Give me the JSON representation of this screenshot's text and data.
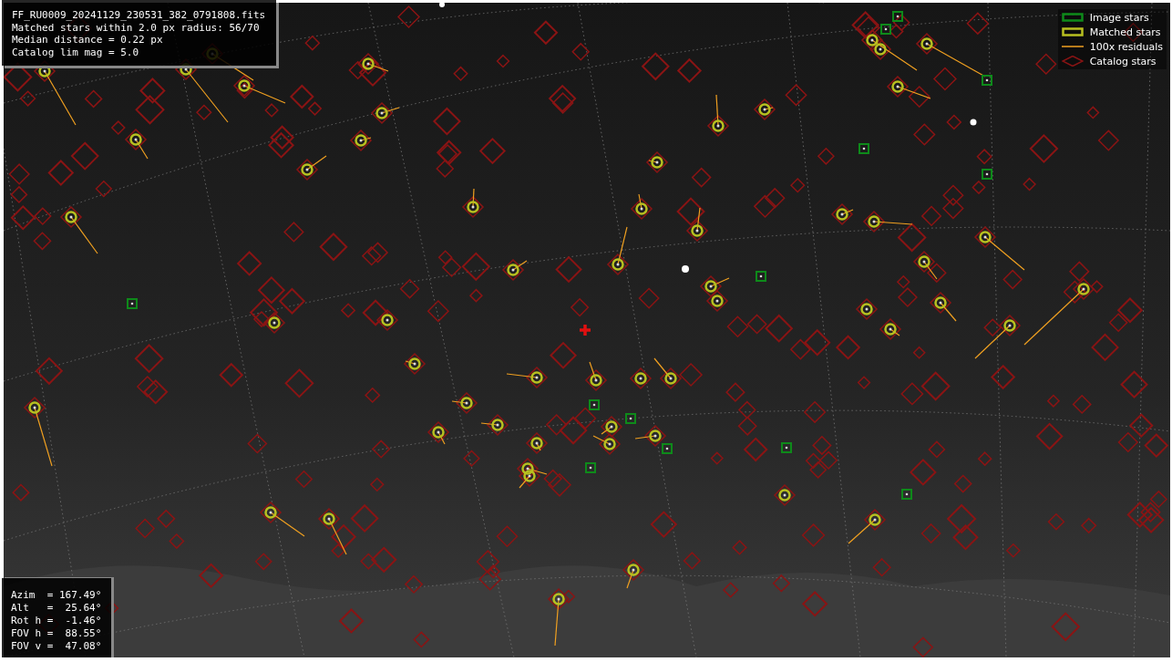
{
  "info_box": {
    "lines": [
      "FF_RU0009_20241129_230531_382_0791808.fits",
      "Matched stars within 2.0 px radius: 56/70",
      "Median distance = 0.22 px",
      "Catalog lim mag = 5.0"
    ]
  },
  "legend": {
    "items": [
      {
        "kind": "image",
        "label": "Image stars"
      },
      {
        "kind": "matched",
        "label": "Matched stars"
      },
      {
        "kind": "residual",
        "label": "100x residuals"
      },
      {
        "kind": "catalog",
        "label": "Catalog stars"
      }
    ]
  },
  "pointing": {
    "lines": [
      "Azim  = 167.49°",
      "Alt   =  25.64°",
      "Rot h =  -1.46°",
      "FOV h =  88.55°",
      "FOV v =  47.08°"
    ]
  }
}
